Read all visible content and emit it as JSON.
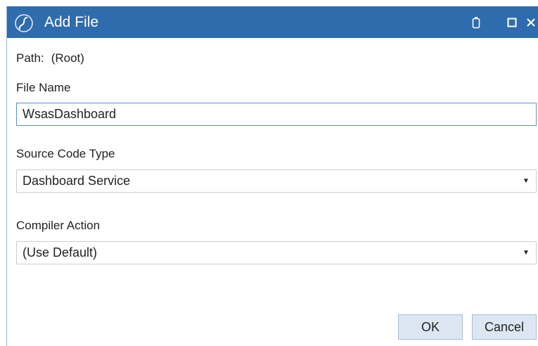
{
  "window": {
    "title": "Add File",
    "app_icon": "sigma-logo-icon",
    "controls": [
      "restore-icon",
      "maximize-icon",
      "close-icon"
    ]
  },
  "path": {
    "label": "Path:",
    "value": "(Root)"
  },
  "file_name": {
    "label": "File Name",
    "value": "WsasDashboard"
  },
  "source_code_type": {
    "label": "Source Code Type",
    "selected": "Dashboard Service"
  },
  "compiler_action": {
    "label": "Compiler Action",
    "selected": "(Use Default)"
  },
  "buttons": {
    "ok_label": "OK",
    "cancel_label": "Cancel"
  },
  "colors": {
    "titlebar": "#2f6cad",
    "button_bg": "#dce7f3",
    "input_focus_border": "#5a8fd0"
  }
}
